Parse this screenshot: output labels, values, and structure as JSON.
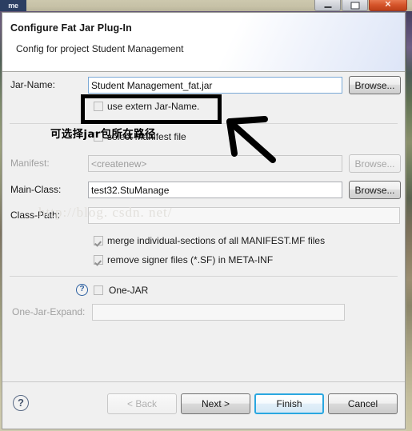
{
  "window": {
    "tab_stub_label": "me",
    "controls": [
      {
        "name": "minimize",
        "glyph": ""
      },
      {
        "name": "maximize",
        "glyph": ""
      },
      {
        "name": "close",
        "glyph": "✕"
      }
    ]
  },
  "header": {
    "title": "Configure Fat Jar Plug-In",
    "subtitle": "Config for project Student Management"
  },
  "form": {
    "jar_name": {
      "label": "Jar-Name:",
      "value": "Student Management_fat.jar",
      "browse_label": "Browse..."
    },
    "use_extern": {
      "label": "use extern Jar-Name.",
      "checked": false
    },
    "select_manifest": {
      "label": "select Manifest file",
      "checked": false
    },
    "manifest": {
      "label": "Manifest:",
      "value": "<createnew>",
      "browse_label": "Browse..."
    },
    "main_class": {
      "label": "Main-Class:",
      "value": "test32.StuManage",
      "browse_label": "Browse..."
    },
    "class_path": {
      "label": "Class-Path:",
      "value": ""
    },
    "merge_sections": {
      "label": "merge individual-sections of all MANIFEST.MF files",
      "checked": true
    },
    "remove_signer": {
      "label": "remove signer files (*.SF) in META-INF",
      "checked": true
    },
    "one_jar": {
      "label": "One-JAR",
      "checked": false,
      "help_glyph": "?"
    },
    "one_jar_expand": {
      "label": "One-Jar-Expand:",
      "value": ""
    }
  },
  "annotation": {
    "text": "可选择jar包所在路径",
    "color": "#000000"
  },
  "watermark": {
    "text": "http://blog. csdn. net/"
  },
  "footer": {
    "help_glyph": "?",
    "buttons": [
      {
        "label": "< Back",
        "state": "disabled"
      },
      {
        "label": "Next >",
        "state": "enabled"
      },
      {
        "label": "Finish",
        "state": "primary"
      },
      {
        "label": "Cancel",
        "state": "enabled"
      }
    ]
  },
  "colors": {
    "accent": "#2aa7e0",
    "dialog_bg": "#f0f0f0",
    "close_button": "#d5542a"
  }
}
